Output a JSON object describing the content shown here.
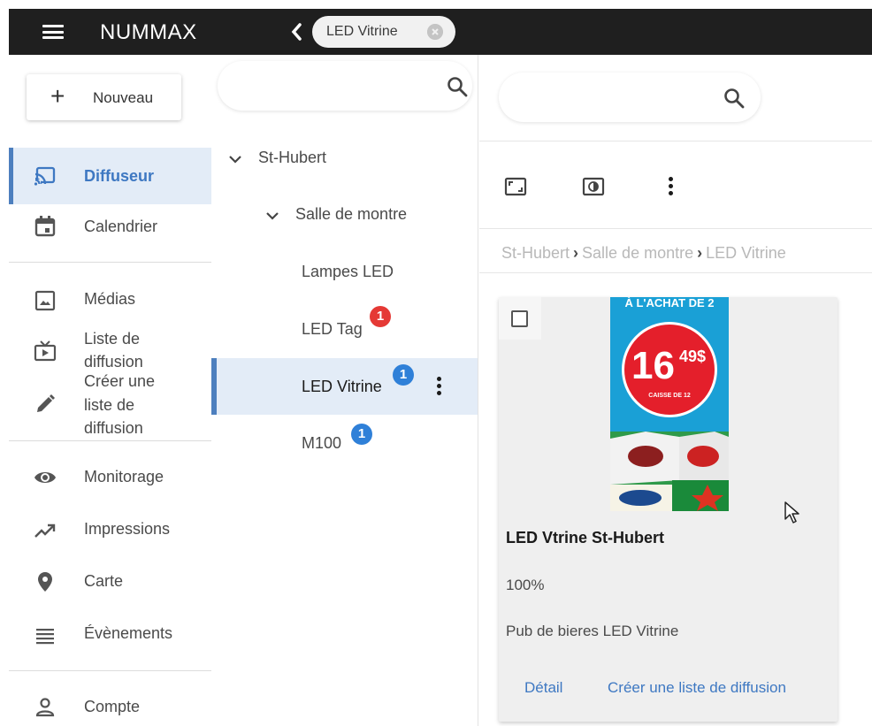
{
  "topbar": {
    "app_title": "NUMMAX",
    "chip_label": "LED Vitrine"
  },
  "sidebar": {
    "new_button_label": "Nouveau",
    "items": [
      {
        "label": "Diffuseur",
        "icon": "cast-icon",
        "active": true
      },
      {
        "label": "Calendrier",
        "icon": "calendar-icon"
      },
      {
        "label": "Médias",
        "icon": "image-icon"
      },
      {
        "label": "Liste de\ndiffusion",
        "icon": "playlist-tv-icon"
      },
      {
        "label": "Créer une\nliste de\ndiffusion",
        "icon": "pencil-icon"
      },
      {
        "label": "Monitorage",
        "icon": "eye-icon"
      },
      {
        "label": "Impressions",
        "icon": "trending-up-icon"
      },
      {
        "label": "Carte",
        "icon": "map-pin-icon"
      },
      {
        "label": "Évènements",
        "icon": "list-icon"
      },
      {
        "label": "Compte",
        "icon": "person-icon"
      }
    ]
  },
  "tree": {
    "search_value": "",
    "nodes": [
      {
        "label": "St-Hubert",
        "expanded": true,
        "level": 0
      },
      {
        "label": "Salle de montre",
        "expanded": true,
        "level": 1
      },
      {
        "label": "Lampes LED",
        "level": 2
      },
      {
        "label": "LED Tag",
        "level": 2,
        "badge": "1",
        "badge_color": "#e53935"
      },
      {
        "label": "LED Vitrine",
        "level": 2,
        "badge": "1",
        "badge_color": "#2f80d8",
        "selected": true
      },
      {
        "label": "M100",
        "level": 2,
        "badge": "1",
        "badge_color": "#2f80d8"
      }
    ]
  },
  "main": {
    "search_value": "",
    "toolbar_icons": [
      "aspect-ratio-icon",
      "brightness-icon",
      "more-vert-icon"
    ],
    "breadcrumb": [
      "St-Hubert",
      "Salle de montre",
      "LED Vitrine"
    ],
    "card": {
      "title": "LED Vtrine St-Hubert",
      "percent": "100%",
      "description": "Pub de bieres LED Vitrine",
      "link_detail": "Détail",
      "link_create": "Créer une liste de diffusion",
      "thumbnail": {
        "banner": "À L'ACHAT DE 2",
        "price": "16",
        "cents": "49$",
        "subtext": "CAISSE DE 12"
      }
    }
  },
  "colors": {
    "accent": "#3e78c2",
    "active_bg": "#e3ecf7",
    "topbar": "#1f1f1f",
    "badge_red": "#e53935",
    "badge_blue": "#2f80d8"
  }
}
